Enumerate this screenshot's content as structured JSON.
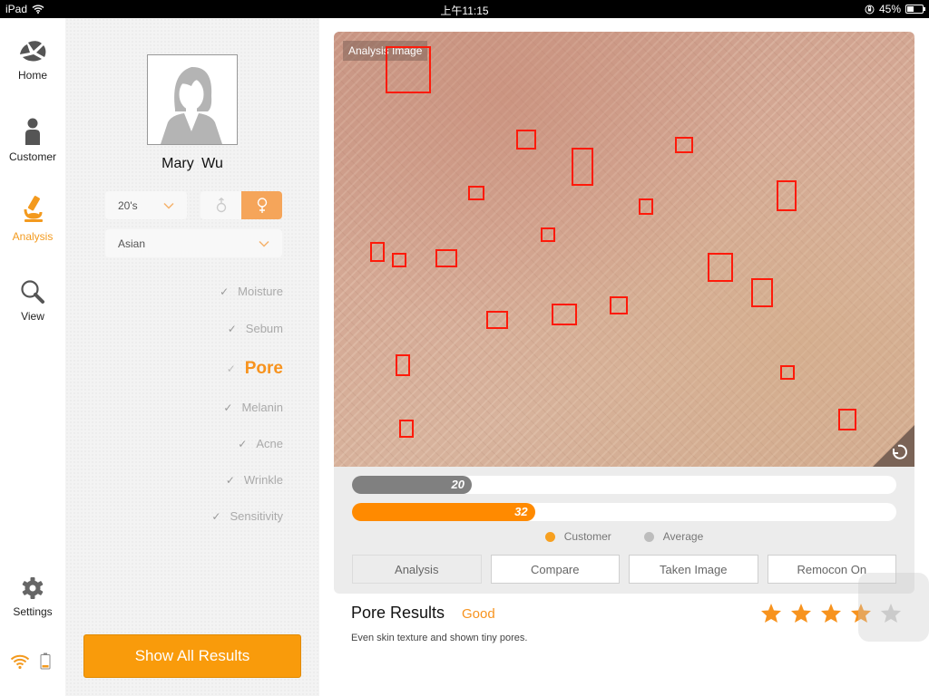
{
  "status_bar": {
    "device": "iPad",
    "time": "上午11:15",
    "battery": "45%",
    "battery_level": 0.45
  },
  "nav": {
    "items": [
      {
        "label": "Home",
        "icon": "home-logo-icon",
        "active": false
      },
      {
        "label": "Customer",
        "icon": "person-icon",
        "active": false
      },
      {
        "label": "Analysis",
        "icon": "microscope-icon",
        "active": true
      },
      {
        "label": "View",
        "icon": "magnifier-icon",
        "active": false
      },
      {
        "label": "Settings",
        "icon": "gear-icon",
        "active": false
      }
    ],
    "footer_icons": [
      "wifi-icon",
      "battery-icon"
    ]
  },
  "profile": {
    "name": "Mary  Wu",
    "age_select": "20's",
    "gender_selected": "female",
    "gender_options": [
      "male",
      "female"
    ],
    "ethnicity_select": "Asian",
    "categories": [
      {
        "label": "Moisture",
        "active": false
      },
      {
        "label": "Sebum",
        "active": false
      },
      {
        "label": "Pore",
        "active": true
      },
      {
        "label": "Melanin",
        "active": false
      },
      {
        "label": "Acne",
        "active": false
      },
      {
        "label": "Wrinkle",
        "active": false
      },
      {
        "label": "Sensitivity",
        "active": false
      }
    ],
    "show_all_label": "Show All Results"
  },
  "analysis": {
    "image_label": "Analysis Image",
    "average_value": 20,
    "customer_value": 32,
    "scale_max": 100,
    "legend": {
      "customer": "Customer",
      "average": "Average"
    },
    "colors": {
      "customer": "#ff8a00",
      "average": "#808080",
      "accent": "#f7931e"
    },
    "buttons": [
      "Analysis",
      "Compare",
      "Taken Image",
      "Remocon On"
    ],
    "active_button": "Analysis"
  },
  "results": {
    "title": "Pore Results",
    "grade": "Good",
    "description": "Even skin texture and shown tiny pores.",
    "rating": 4,
    "rating_max": 5
  }
}
